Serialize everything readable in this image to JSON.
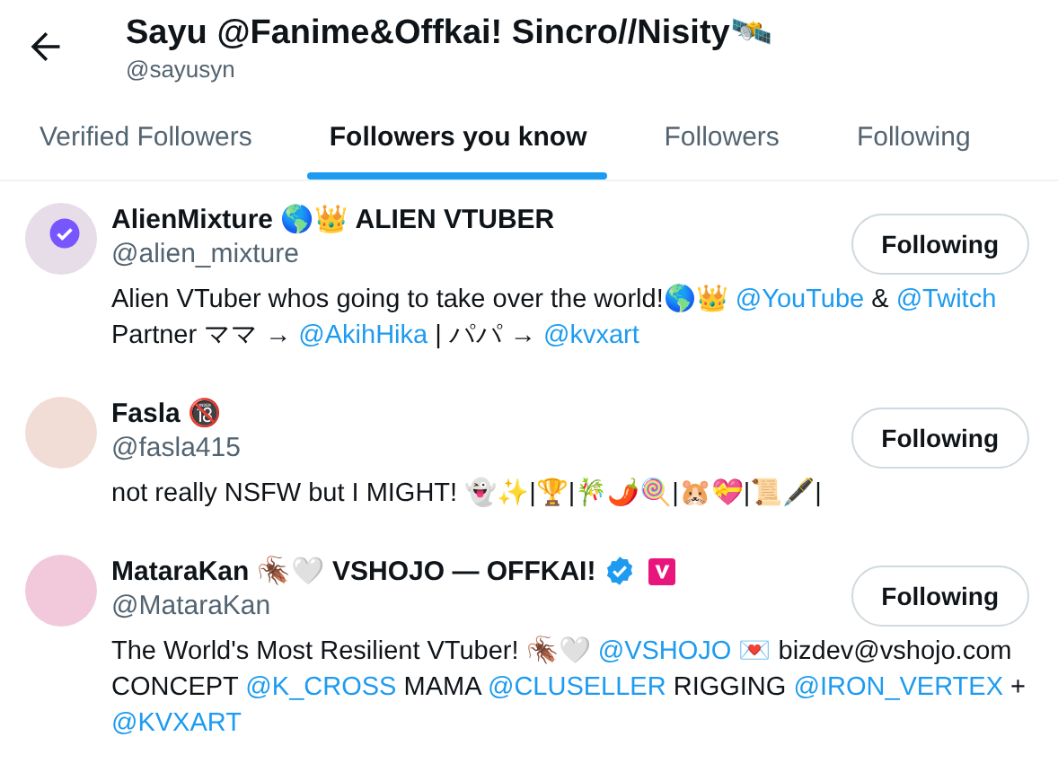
{
  "header": {
    "title": "Sayu @Fanime&Offkai! Sincro//Nisity🛰️",
    "handle": "@sayusyn"
  },
  "tabs": [
    {
      "label": "Verified Followers",
      "selected": false
    },
    {
      "label": "Followers you know",
      "selected": true
    },
    {
      "label": "Followers",
      "selected": false
    },
    {
      "label": "Following",
      "selected": false
    }
  ],
  "users": [
    {
      "name": "AlienMixture 🌎👑 ALIEN VTUBER",
      "handle": "@alien_mixture",
      "avatar_badge": true,
      "verified": false,
      "affiliate": false,
      "button": "Following",
      "bio": [
        {
          "kind": "text",
          "text": "Alien VTuber whos going to take over the world!🌎👑"
        },
        {
          "kind": "link",
          "text": "@YouTube"
        },
        {
          "kind": "text",
          "text": "&"
        },
        {
          "kind": "link",
          "text": "@Twitch"
        },
        {
          "kind": "text",
          "text": "Partner ママ →"
        },
        {
          "kind": "link",
          "text": "@AkihHika"
        },
        {
          "kind": "text",
          "text": "| パパ →"
        },
        {
          "kind": "link",
          "text": "@kvxart"
        }
      ]
    },
    {
      "name": "Fasla 🔞",
      "handle": "@fasla415",
      "avatar_badge": false,
      "verified": false,
      "affiliate": false,
      "button": "Following",
      "bio": [
        {
          "kind": "text",
          "text": "not really NSFW but I MIGHT! 👻✨|🏆|🎋🌶️🍭|🐹💝|📜🖋️|"
        }
      ]
    },
    {
      "name": "MataraKan 🪳🤍 VSHOJO — OFFKAI!",
      "handle": "@MataraKan",
      "avatar_badge": false,
      "verified": true,
      "affiliate": true,
      "button": "Following",
      "bio": [
        {
          "kind": "text",
          "text": "The World's Most Resilient VTuber! 🪳🤍"
        },
        {
          "kind": "link",
          "text": "@VSHOJO"
        },
        {
          "kind": "text",
          "text": "💌 bizdev@vshojo.com CONCEPT"
        },
        {
          "kind": "link",
          "text": "@K_CROSS"
        },
        {
          "kind": "text",
          "text": "MAMA"
        },
        {
          "kind": "link",
          "text": "@CLUSELLER"
        },
        {
          "kind": "text",
          "text": "RIGGING"
        },
        {
          "kind": "link",
          "text": "@IRON_VERTEX"
        },
        {
          "kind": "text",
          "text": "+"
        },
        {
          "kind": "link",
          "text": "@KVXART"
        }
      ]
    }
  ]
}
